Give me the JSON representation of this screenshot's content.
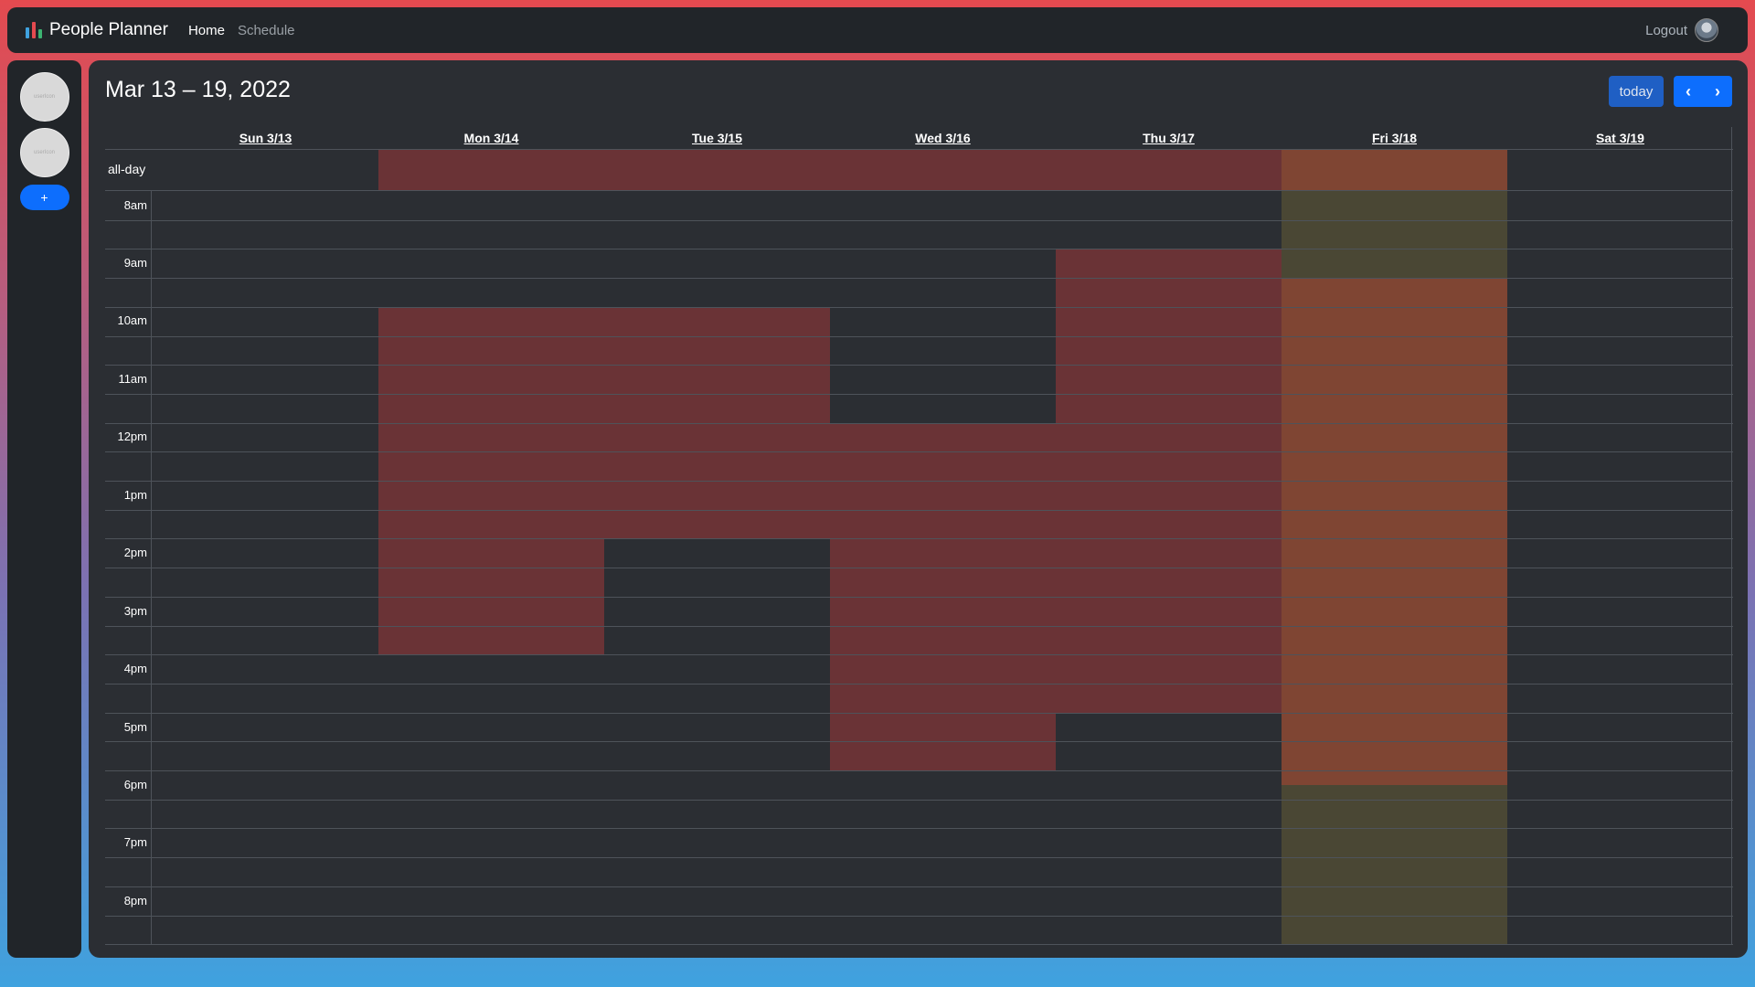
{
  "navbar": {
    "brand": "People Planner",
    "links": [
      "Home",
      "Schedule"
    ],
    "logout": "Logout"
  },
  "sidebar": {
    "people": [
      {
        "placeholder": "userIcon"
      },
      {
        "placeholder": "userIcon"
      }
    ],
    "add_label": "+"
  },
  "calendar": {
    "title": "Mar 13 – 19, 2022",
    "today_label": "today",
    "prev_icon": "chevron-left-icon",
    "next_icon": "chevron-right-icon",
    "days": [
      "Sun 3/13",
      "Mon 3/14",
      "Tue 3/15",
      "Wed 3/16",
      "Thu 3/17",
      "Fri 3/18",
      "Sat 3/19"
    ],
    "all_day_label": "all-day",
    "time_labels": [
      "8am",
      "9am",
      "10am",
      "11am",
      "12pm",
      "1pm",
      "2pm",
      "3pm",
      "4pm",
      "5pm",
      "6pm",
      "7pm",
      "8pm"
    ]
  },
  "colors": {
    "busy_red": "#6a3336",
    "busy_orange": "#7f4533",
    "partial_olive": "#4a4734",
    "primary": "#0d6efd"
  }
}
